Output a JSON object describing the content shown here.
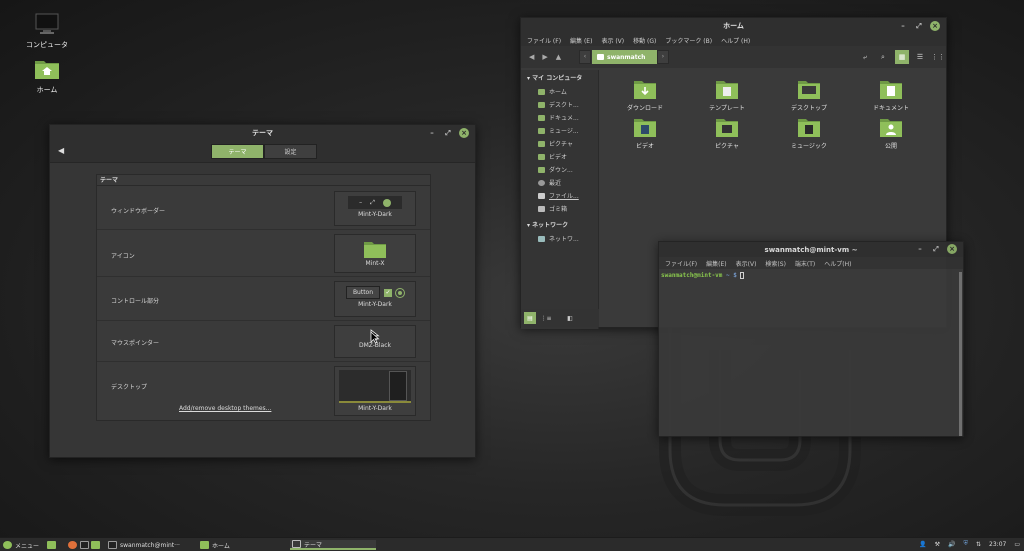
{
  "desktop": {
    "icons": [
      {
        "label": "コンピュータ",
        "icon": "computer-icon"
      },
      {
        "label": "ホーム",
        "icon": "home-folder-icon"
      }
    ]
  },
  "theme_window": {
    "title": "テーマ",
    "tabs": [
      {
        "label": "テーマ",
        "active": true
      },
      {
        "label": "設定",
        "active": false
      }
    ],
    "section_title": "テーマ",
    "rows": [
      {
        "label": "ウィンドウボーダー",
        "value": "Mint-Y-Dark"
      },
      {
        "label": "アイコン",
        "value": "Mint-X"
      },
      {
        "label": "コントロール部分",
        "value": "Mint-Y-Dark",
        "button_preview": "Button"
      },
      {
        "label": "マウスポインター",
        "value": "DMZ-Black"
      },
      {
        "label": "デスクトップ",
        "value": "Mint-Y-Dark"
      }
    ],
    "add_remove_link": "Add/remove desktop themes..."
  },
  "file_manager": {
    "title": "ホーム",
    "menu": [
      "ファイル (F)",
      "編集 (E)",
      "表示 (V)",
      "移動 (G)",
      "ブックマーク (B)",
      "ヘルプ (H)"
    ],
    "path": "swanmatch",
    "sidebar": {
      "my_computer": "マイ コンピュータ",
      "places": [
        "ホーム",
        "デスクト...",
        "ドキュメ...",
        "ミュージ...",
        "ピクチャ",
        "ビデオ",
        "ダウン...",
        "最近",
        "ファイル...",
        "ゴミ箱"
      ],
      "network": "ネットワーク",
      "network_items": [
        "ネットワ..."
      ]
    },
    "folders": [
      "ダウンロード",
      "テンプレート",
      "デスクトップ",
      "ドキュメント",
      "ビデオ",
      "ピクチャ",
      "ミュージック",
      "公開"
    ]
  },
  "terminal": {
    "title": "swanmatch@mint-vm ~",
    "menu": [
      "ファイル(F)",
      "編集(E)",
      "表示(V)",
      "検索(S)",
      "端末(T)",
      "ヘルプ(H)"
    ],
    "prompt_user": "swanmatch@mint-vm",
    "prompt_tail": " ~ $ "
  },
  "taskbar": {
    "menu_label": "メニュー",
    "tasks": [
      {
        "label": "swanmatch@mint···",
        "active": false
      },
      {
        "label": "ホーム",
        "active": false
      },
      {
        "label": "テーマ",
        "active": true
      }
    ],
    "clock": "23:07"
  },
  "colors": {
    "accent": "#8fb36a",
    "window_bg": "#383838",
    "titlebar": "#2f2f2f"
  }
}
